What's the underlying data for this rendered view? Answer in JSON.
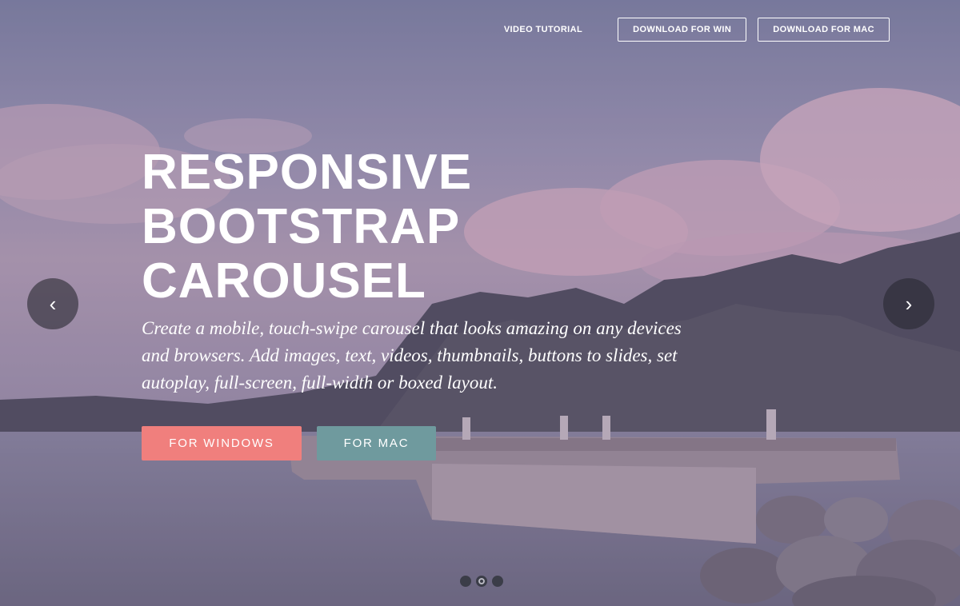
{
  "nav": {
    "video_tutorial": "VIDEO TUTORIAL",
    "download_win": "DOWNLOAD FOR WIN",
    "download_mac": "DOWNLOAD FOR MAC"
  },
  "hero": {
    "title": "RESPONSIVE BOOTSTRAP CAROUSEL",
    "subtitle": "Create a mobile, touch-swipe carousel that looks amazing on any devices and browsers. Add images, text, videos, thumbnails, buttons to slides, set autoplay, full-screen, full-width or boxed layout.",
    "cta_windows": "FOR WINDOWS",
    "cta_mac": "FOR MAC"
  },
  "carousel": {
    "prev_glyph": "‹",
    "next_glyph": "›",
    "slide_count": 3,
    "active_slide": 2
  },
  "colors": {
    "cta_windows": "#f07f7d",
    "cta_mac": "#6f9a9e",
    "arrow_bg": "#2a2a32"
  },
  "icons": {
    "prev": "chevron-left-icon",
    "next": "chevron-right-icon"
  }
}
